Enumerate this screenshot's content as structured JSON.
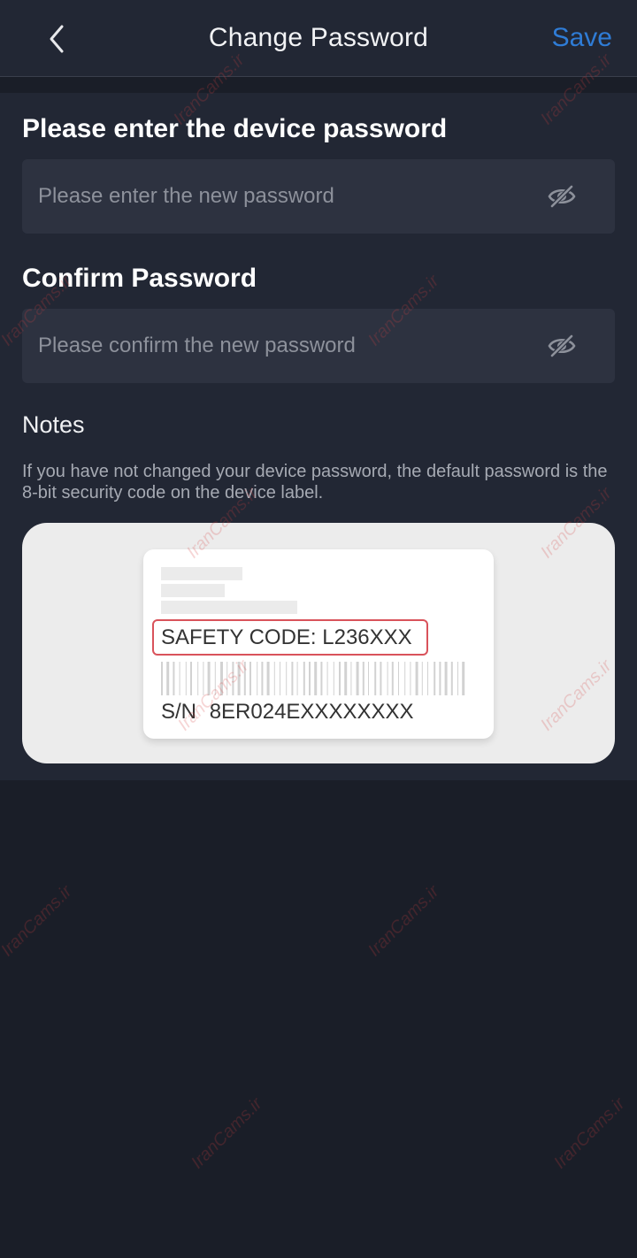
{
  "header": {
    "title": "Change Password",
    "save_label": "Save"
  },
  "device_password": {
    "title": "Please enter the device password",
    "placeholder": "Please enter the new password"
  },
  "confirm_password": {
    "title": "Confirm Password",
    "placeholder": "Please confirm the new password"
  },
  "notes": {
    "title": "Notes",
    "text": "If you have not changed your device password, the default password is the 8-bit security code on the device label."
  },
  "label_example": {
    "safety_code": "SAFETY CODE: L236XXX",
    "sn_prefix": "S/N",
    "sn_value": "8ER024EXXXXXXXX"
  },
  "watermark": "IranCams.ir",
  "colors": {
    "accent": "#2f7cd6",
    "highlight_border": "#d9535b",
    "background": "#1a1e28",
    "panel": "#222734",
    "input": "#2d3240"
  },
  "icons": {
    "back": "chevron-left-icon",
    "toggle_visibility": "eye-off-icon"
  }
}
